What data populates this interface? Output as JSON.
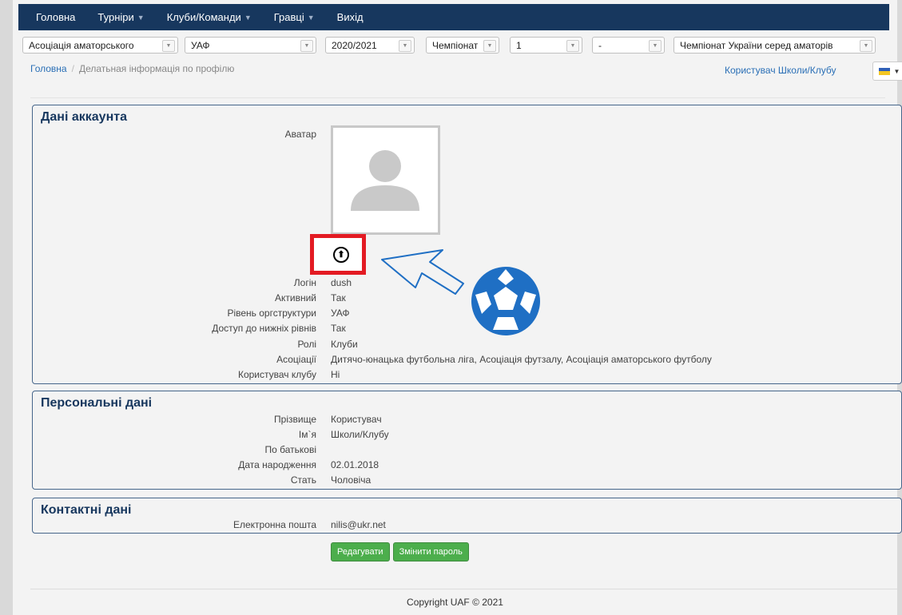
{
  "nav": {
    "items": [
      {
        "label": "Головна",
        "dropdown": false
      },
      {
        "label": "Турніри",
        "dropdown": true
      },
      {
        "label": "Клуби/Команди",
        "dropdown": true
      },
      {
        "label": "Гравці",
        "dropdown": true
      },
      {
        "label": "Вихід",
        "dropdown": false
      }
    ]
  },
  "filters": {
    "association": "Асоціація аматорського",
    "organization": "УАФ",
    "season": "2020/2021",
    "type": "Чемпіонат",
    "level": "1",
    "group": "-",
    "tournament": "Чемпіонат України серед аматорів"
  },
  "breadcrumb": {
    "home": "Головна",
    "separator": "/",
    "current": "Делатьная інформація по профілю"
  },
  "user": {
    "link": "Користувач Школи/Клубу"
  },
  "account": {
    "title": "Дані аккаунта",
    "avatar_label": "Аватар",
    "fields": [
      {
        "label": "Логін",
        "value": "dush"
      },
      {
        "label": "Активний",
        "value": "Так"
      },
      {
        "label": "Рівень оргструктури",
        "value": "УАФ"
      },
      {
        "label": "Доступ до нижніх рівнів",
        "value": "Так"
      },
      {
        "label": "Ролі",
        "value": "Клуби"
      },
      {
        "label": "Асоціації",
        "value": "Дитячо-юнацька футбольна ліга, Асоціація футзалу, Асоціація аматорського футболу"
      },
      {
        "label": "Користувач клубу",
        "value": "Ні"
      }
    ]
  },
  "personal": {
    "title": "Персональні дані",
    "fields": [
      {
        "label": "Прізвище",
        "value": "Користувач"
      },
      {
        "label": "Ім`я",
        "value": "Школи/Клубу"
      },
      {
        "label": "По батькові",
        "value": ""
      },
      {
        "label": "Дата народження",
        "value": "02.01.2018"
      },
      {
        "label": "Стать",
        "value": "Чоловіча"
      }
    ]
  },
  "contacts": {
    "title": "Контактні дані",
    "fields": [
      {
        "label": "Електронна пошта",
        "value": "nilis@ukr.net"
      }
    ]
  },
  "actions": {
    "edit": "Редагувати",
    "change_password": "Змінити пароль"
  },
  "footer": {
    "copyright": "Copyright UAF ©  2021"
  },
  "colors": {
    "navbar": "#17375e",
    "link": "#2a6fb6",
    "button": "#4cae4c",
    "highlight": "#e31b23",
    "annotation_blue": "#1f6fc4"
  }
}
